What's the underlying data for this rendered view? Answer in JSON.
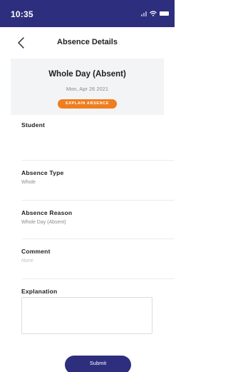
{
  "status_bar": {
    "time": "10:35",
    "icons": [
      "signal-icon",
      "wifi-icon",
      "battery-icon"
    ]
  },
  "header": {
    "title": "Absence Details",
    "back_icon": "chevron-left-icon"
  },
  "summary": {
    "title": "Whole Day (Absent)",
    "date": "Mon, Apr 26 2021",
    "explain_button_label": "EXPLAIN ABSENCE"
  },
  "fields": {
    "student": {
      "label": "Student",
      "value": ""
    },
    "absence_type": {
      "label": "Absence Type",
      "value": "Whole"
    },
    "absence_reason": {
      "label": "Absence Reason",
      "value": "Whole Day (Absent)"
    },
    "comment": {
      "label": "Comment",
      "value": "None"
    }
  },
  "explanation": {
    "label": "Explanation",
    "value": ""
  },
  "submit_label": "Submit",
  "colors": {
    "brand": "#2d2e7e",
    "accent": "#f07d1e",
    "card_background": "#f3f4f6",
    "muted_text": "#8a8a8a"
  }
}
